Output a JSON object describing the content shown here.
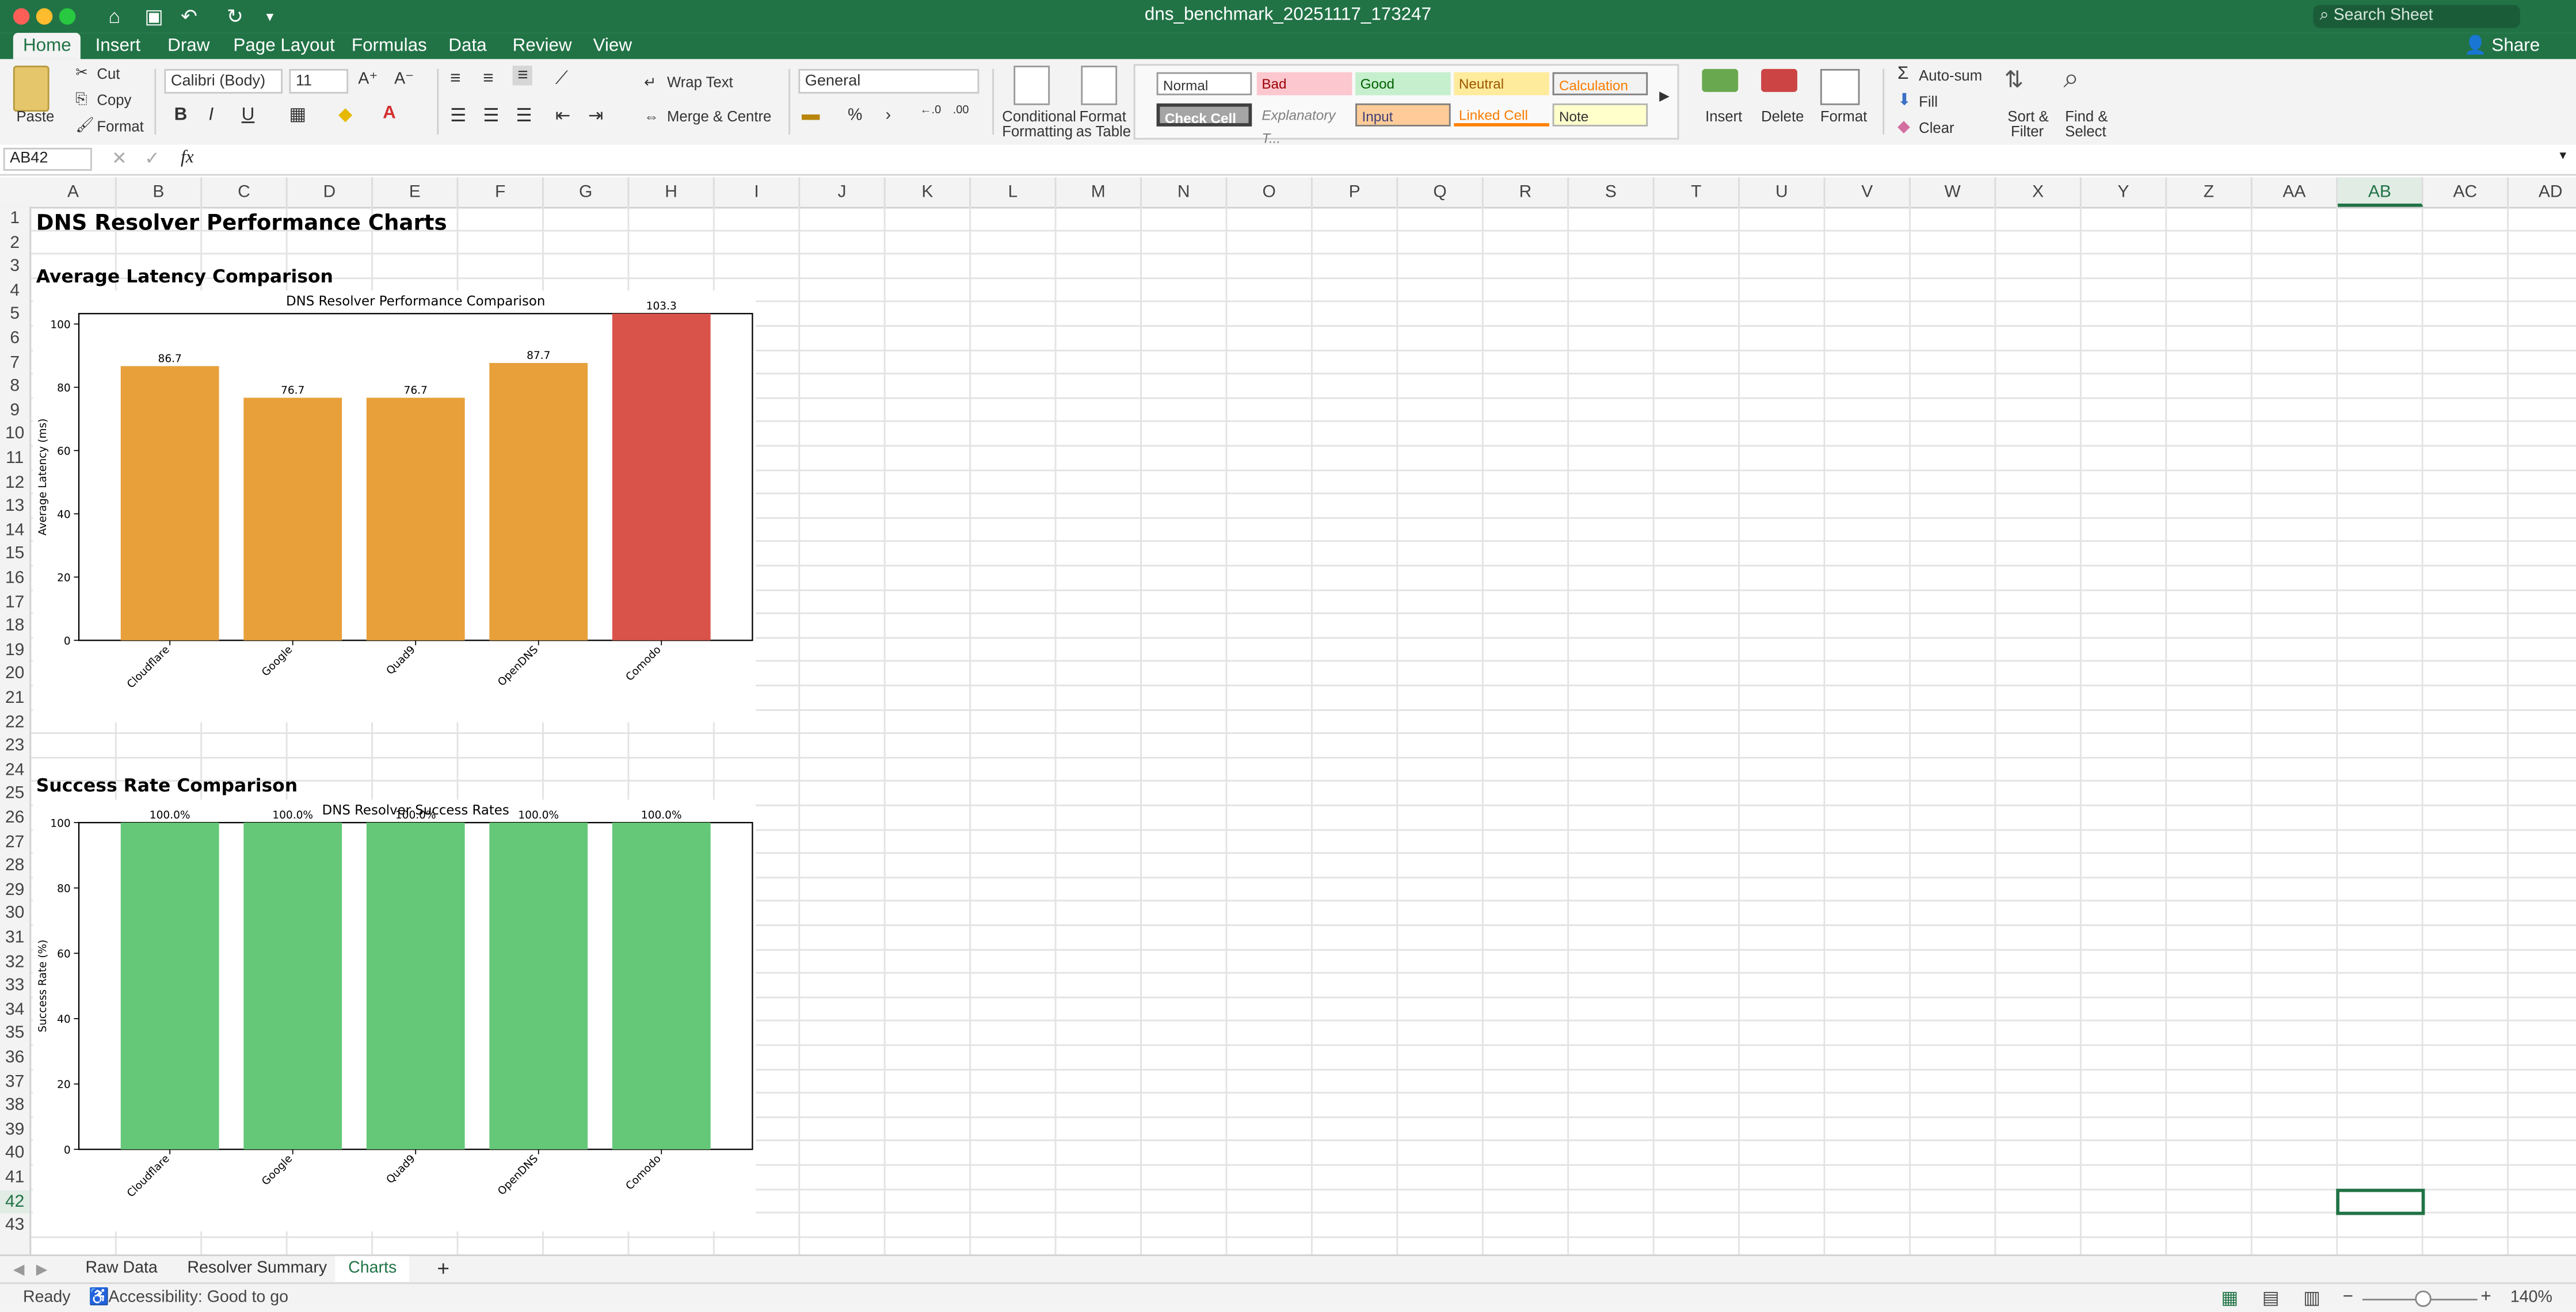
{
  "window": {
    "title": "dns_benchmark_20251117_173247"
  },
  "search": {
    "placeholder": "Search Sheet"
  },
  "menu": {
    "tabs": [
      "Home",
      "Insert",
      "Draw",
      "Page Layout",
      "Formulas",
      "Data",
      "Review",
      "View"
    ],
    "active": "Home",
    "share": "Share"
  },
  "ribbon": {
    "paste": "Paste",
    "cut": "Cut",
    "copy": "Copy",
    "format": "Format",
    "font_name": "Calibri (Body)",
    "font_size": "11",
    "bold": "B",
    "italic": "I",
    "underline": "U",
    "wrap_text": "Wrap Text",
    "merge_center": "Merge & Centre",
    "number_format": "General",
    "percent": "%",
    "comma": "›",
    "cond_format": [
      "Conditional",
      "Formatting"
    ],
    "format_table": [
      "Format",
      "as Table"
    ],
    "styles": [
      "Normal",
      "Bad",
      "Good",
      "Neutral",
      "Calculation",
      "Check Cell",
      "Explanatory T...",
      "Input",
      "Linked Cell",
      "Note"
    ],
    "insert": "Insert",
    "delete": "Delete",
    "format_cells": "Format",
    "autosum": "Auto-sum",
    "fill": "Fill",
    "clear": "Clear",
    "sort_filter": [
      "Sort &",
      "Filter"
    ],
    "find_select": [
      "Find &",
      "Select"
    ]
  },
  "formula_bar": {
    "name_box": "AB42",
    "fx": "fx",
    "value": ""
  },
  "columns": [
    "A",
    "B",
    "C",
    "D",
    "E",
    "F",
    "G",
    "H",
    "I",
    "J",
    "K",
    "L",
    "M",
    "N",
    "O",
    "P",
    "Q",
    "R",
    "S",
    "T",
    "U",
    "V",
    "W",
    "X",
    "Y",
    "Z",
    "AA",
    "AB",
    "AC",
    "AD"
  ],
  "selected_column": "AB",
  "selected_row": 42,
  "rows": [
    "1",
    "2",
    "3",
    "4",
    "5",
    "6",
    "7",
    "8",
    "9",
    "10",
    "11",
    "12",
    "13",
    "14",
    "15",
    "16",
    "17",
    "18",
    "19",
    "20",
    "21",
    "22",
    "23",
    "24",
    "25",
    "26",
    "27",
    "28",
    "29",
    "30",
    "31",
    "32",
    "33",
    "34",
    "35",
    "36",
    "37",
    "38",
    "39",
    "40",
    "41",
    "42",
    "43"
  ],
  "cells": {
    "A1": "DNS Resolver Performance Charts",
    "A3": "Average Latency Comparison",
    "A24": "Success Rate Comparison"
  },
  "chart_data": [
    {
      "type": "bar",
      "title": "DNS Resolver Performance Comparison",
      "xlabel": "",
      "ylabel": "Average Latency (ms)",
      "categories": [
        "Cloudflare",
        "Google",
        "Quad9",
        "OpenDNS",
        "Comodo"
      ],
      "values": [
        86.7,
        76.7,
        76.7,
        87.7,
        103.3
      ],
      "data_labels": [
        "86.7",
        "76.7",
        "76.7",
        "87.7",
        "103.3"
      ],
      "colors": [
        "#e8a03b",
        "#e8a03b",
        "#e8a03b",
        "#e8a03b",
        "#d9534a"
      ],
      "yticks": [
        0,
        20,
        40,
        60,
        80,
        100
      ],
      "ylim": [
        0,
        103.3
      ],
      "grid": false
    },
    {
      "type": "bar",
      "title": "DNS Resolver Success Rates",
      "xlabel": "",
      "ylabel": "Success Rate (%)",
      "categories": [
        "Cloudflare",
        "Google",
        "Quad9",
        "OpenDNS",
        "Comodo"
      ],
      "values": [
        100,
        100,
        100,
        100,
        100
      ],
      "data_labels": [
        "100.0%",
        "100.0%",
        "100.0%",
        "100.0%",
        "100.0%"
      ],
      "colors": [
        "#64c878",
        "#64c878",
        "#64c878",
        "#64c878",
        "#64c878"
      ],
      "yticks": [
        0,
        20,
        40,
        60,
        80,
        100
      ],
      "ylim": [
        0,
        100
      ],
      "grid": false
    }
  ],
  "sheets": {
    "tabs": [
      "Raw Data",
      "Resolver Summary",
      "Charts"
    ],
    "active": "Charts",
    "add": "+"
  },
  "status": {
    "ready": "Ready",
    "accessibility": "Accessibility: Good to go",
    "zoom": "140%"
  },
  "colors": {
    "accent": "#217346"
  }
}
